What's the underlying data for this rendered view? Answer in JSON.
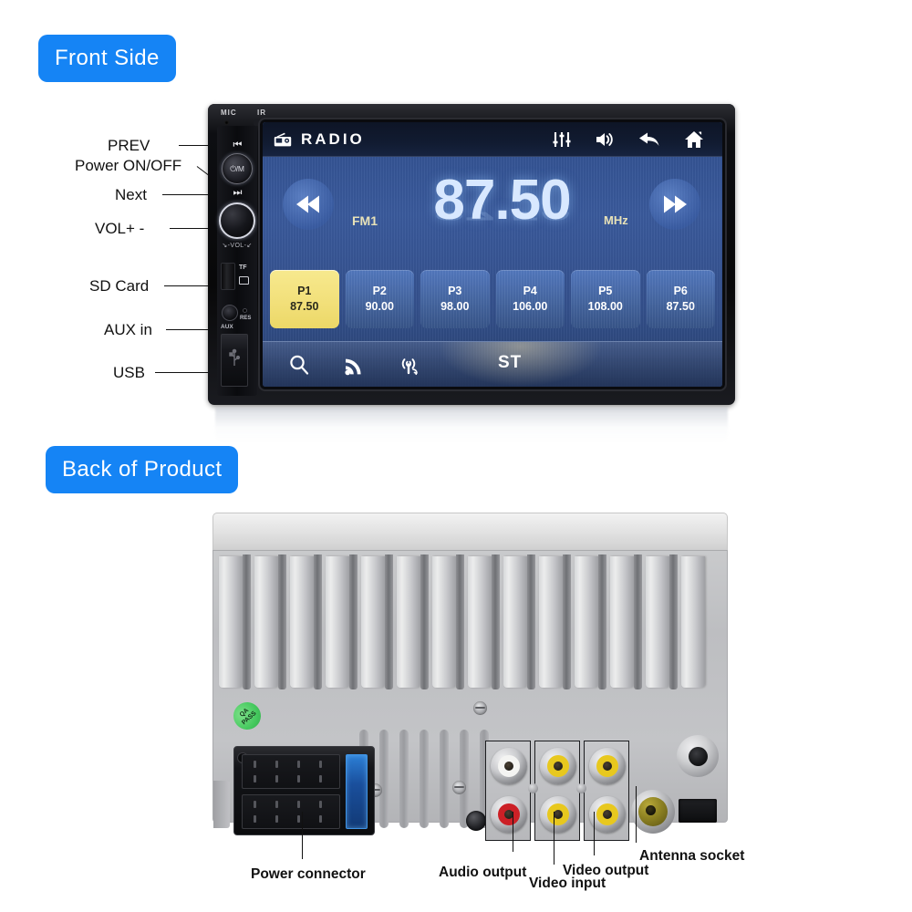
{
  "sections": {
    "front_pill": "Front Side",
    "back_pill": "Back of Product"
  },
  "front_callouts": [
    {
      "label": "PREV"
    },
    {
      "label": "Power ON/OFF"
    },
    {
      "label": "Next"
    },
    {
      "label": "VOL+ -"
    },
    {
      "label": "SD Card"
    },
    {
      "label": "AUX in"
    },
    {
      "label": "USB"
    }
  ],
  "bezel": {
    "mic_label": "MIC",
    "ir_label": "IR",
    "power_button_label": "⏻/M",
    "prev_glyph": "⏮",
    "next_glyph": "⏭",
    "vol_label": "↘-VOL-↙",
    "tf_label": "TF",
    "res_label": "RES",
    "aux_label": "AUX",
    "usb_glyph": "ᴮ"
  },
  "screen": {
    "topbar": {
      "title": "RADIO",
      "icons": [
        "radio-icon",
        "equalizer-icon",
        "volume-icon",
        "back-arrow-icon",
        "home-icon"
      ]
    },
    "tuner": {
      "band": "FM1",
      "frequency": "87.50",
      "unit": "MHz",
      "prev_glyph": "⏮",
      "next_glyph": "⏭"
    },
    "presets": [
      {
        "name": "P1",
        "freq": "87.50",
        "active": true
      },
      {
        "name": "P2",
        "freq": "90.00",
        "active": false
      },
      {
        "name": "P3",
        "freq": "98.00",
        "active": false
      },
      {
        "name": "P4",
        "freq": "106.00",
        "active": false
      },
      {
        "name": "P5",
        "freq": "108.00",
        "active": false
      },
      {
        "name": "P6",
        "freq": "87.50",
        "active": false
      }
    ],
    "bottombar": {
      "stereo_label": "ST",
      "icons": [
        "search-icon",
        "signal-icon",
        "antenna-scan-icon"
      ]
    },
    "colors": {
      "screen_blue": "#3a5a9c",
      "preset_active": "#f2e07a",
      "accent_yellow": "#e8e2b8",
      "topbar_dark": "#111b31"
    }
  },
  "back": {
    "qa_sticker_line1": "QA",
    "qa_sticker_line2": "PASS",
    "callouts": [
      {
        "label": "Power connector"
      },
      {
        "label": "Audio output"
      },
      {
        "label": "Video input"
      },
      {
        "label": "Video output"
      },
      {
        "label": "Antenna socket"
      }
    ]
  },
  "theme": {
    "pill_blue": "#1584f5",
    "page_background": "#ffffff",
    "label_text": "#111111"
  }
}
